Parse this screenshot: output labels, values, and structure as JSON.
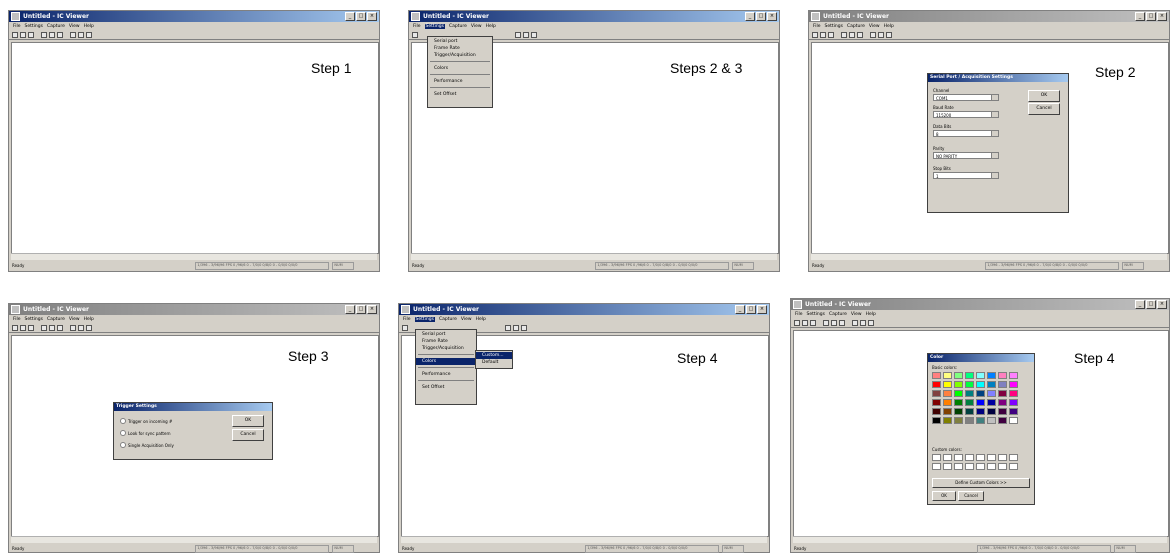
{
  "app": {
    "title": "Untitled - IC Viewer",
    "menu": [
      "File",
      "Settings",
      "Capture",
      "View",
      "Help"
    ],
    "status_ready": "Ready",
    "status_fields": "1/396 - 3/96/96 FPS 0 /96/6 0 - 7/0/0 0/8/0 0 - 0/0/0 0/0/0",
    "status_zoom": "NUM"
  },
  "steps": {
    "s1": "Step 1",
    "s2": "Steps 2 & 3",
    "s3": "Step 2",
    "s4": "Step 3",
    "s5": "Step 4",
    "s6": "Step 4"
  },
  "settings_menu": [
    "Serial port",
    "Frame Rate",
    "Trigger/Acquisition",
    "Colors",
    "Performance",
    "Set Offset"
  ],
  "colors_submenu": [
    "Custom...",
    "Default"
  ],
  "serial_dialog": {
    "title": "Serial Port / Acquisition Settings",
    "ok": "OK",
    "cancel": "Cancel",
    "fields": [
      {
        "label": "Channel",
        "value": "COM1"
      },
      {
        "label": "Baud Rate",
        "value": "115200"
      },
      {
        "label": "Data Bits",
        "value": "8"
      },
      {
        "label": "Parity",
        "value": "NO PARITY"
      },
      {
        "label": "Stop Bits",
        "value": "1"
      }
    ]
  },
  "trigger_dialog": {
    "title": "Trigger Settings",
    "ok": "OK",
    "cancel": "Cancel",
    "options": [
      "Trigger on incoming #",
      "Look for sync pattern",
      "Single Acquisition Only"
    ]
  },
  "color_dialog": {
    "title": "Color",
    "basic_label": "Basic colors:",
    "custom_label": "Custom colors:",
    "define_button": "Define Custom Colors >>",
    "ok": "OK",
    "cancel": "Cancel",
    "basic_colors": [
      "#ff8080",
      "#ffff80",
      "#80ff80",
      "#00ff80",
      "#80ffff",
      "#0080ff",
      "#ff80c0",
      "#ff80ff",
      "#ff0000",
      "#ffff00",
      "#80ff00",
      "#00ff40",
      "#00ffff",
      "#0080c0",
      "#8080c0",
      "#ff00ff",
      "#804040",
      "#ff8040",
      "#00ff00",
      "#008080",
      "#004080",
      "#8080ff",
      "#800040",
      "#ff0080",
      "#800000",
      "#ff8000",
      "#008000",
      "#008040",
      "#0000ff",
      "#0000a0",
      "#800080",
      "#8000ff",
      "#400000",
      "#804000",
      "#004000",
      "#004040",
      "#000080",
      "#000040",
      "#400040",
      "#400080",
      "#000000",
      "#808000",
      "#808040",
      "#808080",
      "#408080",
      "#c0c0c0",
      "#400040",
      "#ffffff"
    ]
  }
}
